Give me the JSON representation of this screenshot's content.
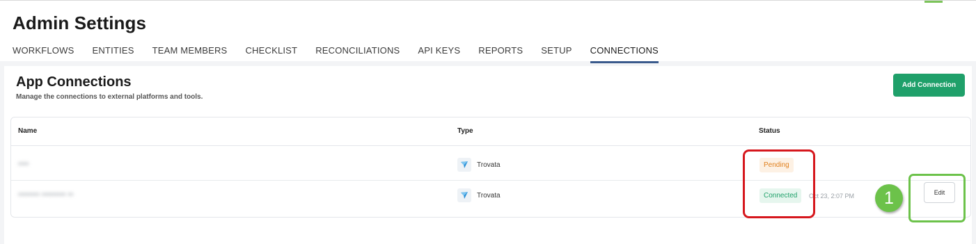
{
  "header": {
    "title": "Admin Settings"
  },
  "tabs": [
    {
      "label": "WORKFLOWS"
    },
    {
      "label": "ENTITIES"
    },
    {
      "label": "TEAM MEMBERS"
    },
    {
      "label": "CHECKLIST"
    },
    {
      "label": "RECONCILIATIONS"
    },
    {
      "label": "API KEYS"
    },
    {
      "label": "REPORTS"
    },
    {
      "label": "SETUP"
    },
    {
      "label": "CONNECTIONS",
      "active": true
    }
  ],
  "connections": {
    "title": "App Connections",
    "subtitle": "Manage the connections to external platforms and tools.",
    "add_button_label": "Add Connection",
    "columns": {
      "name": "Name",
      "type": "Type",
      "status": "Status"
    },
    "rows": [
      {
        "name": "••••",
        "type": "Trovata",
        "status": "Pending",
        "timestamp": "",
        "action": ""
      },
      {
        "name": "•••••••• ••••••••• ••",
        "type": "Trovata",
        "status": "Connected",
        "timestamp": "Oct 23, 2:07 PM",
        "action": "Edit"
      }
    ]
  },
  "annotation": {
    "step_number": "1"
  },
  "colors": {
    "accent_green": "#1fa06a",
    "tab_underline": "#3a5a8c",
    "pending": "#e0801e",
    "connected": "#1fa06a",
    "annotation_red": "#d6171d",
    "annotation_green": "#6cc24a"
  }
}
